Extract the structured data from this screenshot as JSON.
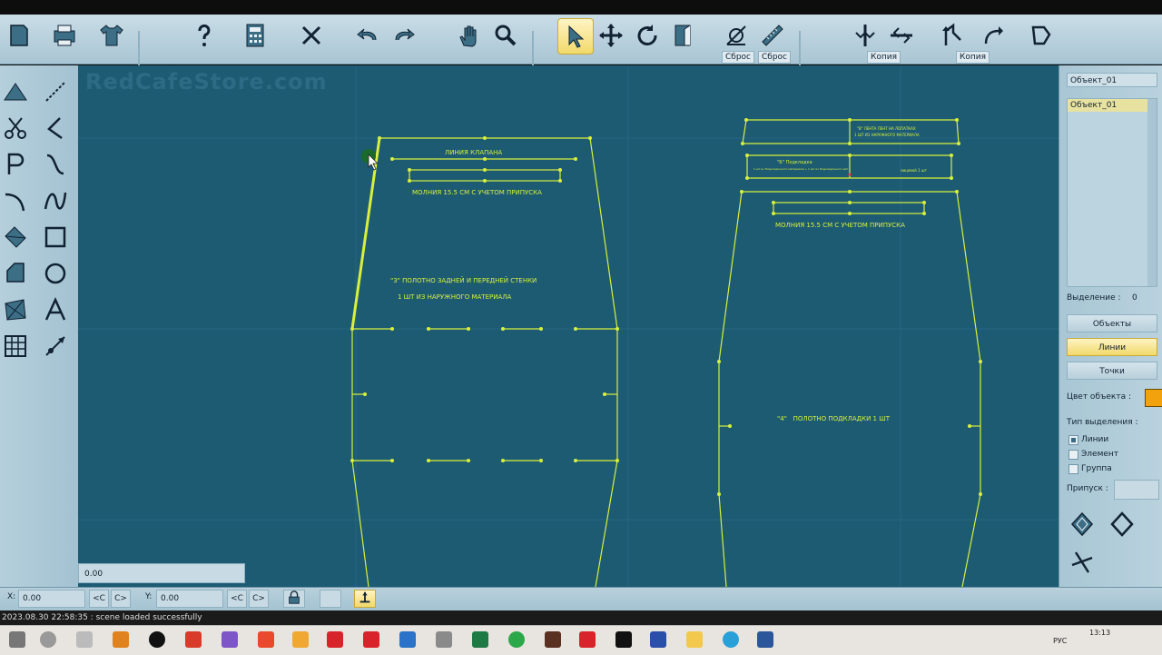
{
  "toolbar": {
    "labels": {
      "reset1": "Сброс",
      "reset2": "Сброс",
      "copy1": "Копия",
      "copy2": "Копия"
    }
  },
  "canvas": {
    "watermark": "RedCafeStore.com",
    "front_piece": {
      "label_flap_line": "ЛИНИЯ КЛАПАНА",
      "label_zipper": "МОЛНИЯ 15.5 СМ С УЧЕТОМ ПРИПУСКА",
      "label_piece_line1": "\"3\" ПОЛОТНО ЗАДНЕЙ И ПЕРЕДНЕЙ СТЕНКИ",
      "label_piece_line2": "1 ШТ ИЗ НАРУЖНОГО МАТЕРИАЛА"
    },
    "lining_piece": {
      "label_top": "\"В\" ЛЕНТА ПЕНТ НА ЛОПАТКАХ",
      "label_top2": "1 ШТ ИЗ НАРУЖНОГО МАТЕРИАЛА",
      "label_mid_left": "\"Б\" Подкладка",
      "label_mid_small": "1 шт из Подкладочного материала + 1 шт из Подкладочного мат.",
      "label_mid_right": "лицевой 1 шт",
      "label_zipper": "МОЛНИЯ 15.5 СМ С УЧЕТОМ ПРИПУСКА",
      "label_piece": "\"4\"   ПОЛОТНО ПОДКЛАДКИ 1 ШТ"
    },
    "coord_readout": "0.00"
  },
  "right_panel": {
    "object_name": "Объект_01",
    "list_selected": "Объект_01",
    "selection_label": "Выделение :",
    "selection_count": "0",
    "btn_objects": "Объекты",
    "btn_lines": "Линии",
    "btn_points": "Точки",
    "object_color_label": "Цвет объекта :",
    "object_color": "#f2a20c",
    "selection_type_label": "Тип выделения :",
    "opt_lines": "Линии",
    "opt_element": "Элемент",
    "opt_group": "Группа",
    "allowance_label": "Припуск :"
  },
  "bottom": {
    "x_label": "X:",
    "x_value": "0.00",
    "y_label": "Y:",
    "y_value": "0.00",
    "prev_btn": "<C",
    "next_btn": "C>"
  },
  "status": {
    "message": "2023.08.30 22:58:35 : scene loaded successfully"
  },
  "taskbar": {
    "time": "13:13",
    "lang": "РУС"
  }
}
